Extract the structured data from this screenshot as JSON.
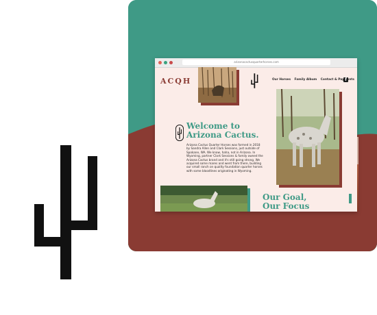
{
  "brand": {
    "teal": "#3f9a86",
    "rust": "#8a3b33",
    "blush": "#fbece8",
    "ink": "#111111"
  },
  "browser": {
    "url": "arizonacactusquarterhorses.com"
  },
  "site": {
    "logo": "ACQH",
    "nav": [
      "Our Horses",
      "Family Album",
      "Contact & Payments"
    ],
    "social_icon": "facebook-icon",
    "welcome_title_line1": "Welcome to",
    "welcome_title_line2": "Arizona Cactus.",
    "welcome_body": "Arizona Cactus Quarter Horses was formed in 2018 by Sandra Allen and Clark Sessions, just outside of Spokane, WA. We know, haha, not in Arizona. In Wyoming, partner Clark Sessions & family owned the Arizona Cactus brand and it's still going strong. We acquired some mares and went from there, building our small ranch on quality foundation quarter horses with some bloodlines originating in Wyoming.",
    "goal_line1": "Our Goal,",
    "goal_line2": "Our Focus"
  },
  "icons": {
    "big_logo": "cactus-icon",
    "nav_logo": "cactus-icon",
    "welcome_logo": "cactus-icon"
  }
}
